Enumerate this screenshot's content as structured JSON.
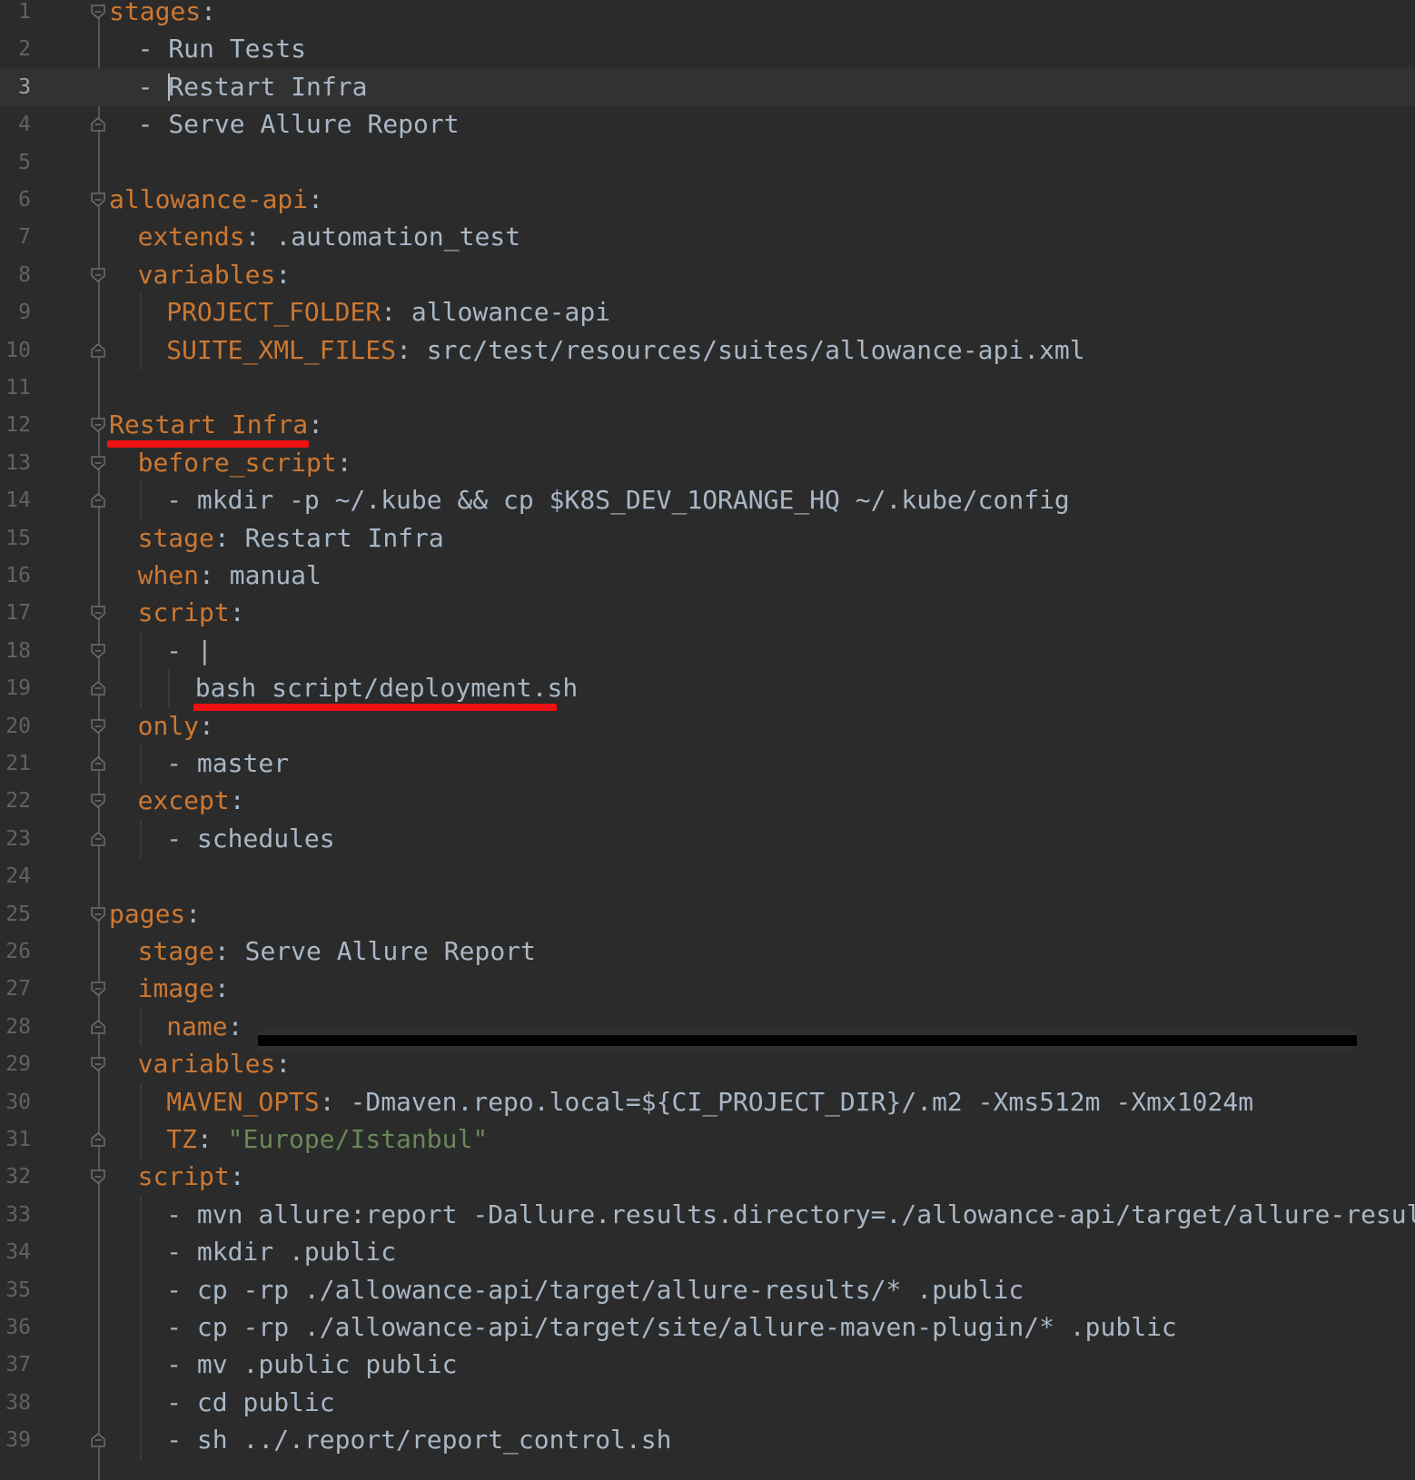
{
  "editor": {
    "theme": "dark",
    "colors": {
      "background": "#2b2b2b",
      "key": "#cc7832",
      "value": "#a9b7c6",
      "string": "#6a8759",
      "line_number": "#606366",
      "highlight": "#ee1111"
    },
    "current_line": 3,
    "lines": [
      {
        "n": "1",
        "indent": 0,
        "fold": "open",
        "key": "stages",
        "colon": ":",
        "value": ""
      },
      {
        "n": "2",
        "indent": 1,
        "fold": "",
        "dash": "- ",
        "value": "Run Tests"
      },
      {
        "n": "3",
        "indent": 1,
        "fold": "",
        "dash": "- ",
        "value": "Restart Infra",
        "caret": true
      },
      {
        "n": "4",
        "indent": 1,
        "fold": "close",
        "dash": "- ",
        "value": "Serve Allure Report"
      },
      {
        "n": "5",
        "indent": 0,
        "fold": "",
        "value": ""
      },
      {
        "n": "6",
        "indent": 0,
        "fold": "open",
        "key": "allowance-api",
        "colon": ":",
        "value": ""
      },
      {
        "n": "7",
        "indent": 1,
        "fold": "",
        "key": "extends",
        "colon": ": ",
        "value": ".automation_test"
      },
      {
        "n": "8",
        "indent": 1,
        "fold": "open",
        "key": "variables",
        "colon": ":",
        "value": ""
      },
      {
        "n": "9",
        "indent": 2,
        "fold": "",
        "key": "PROJECT_FOLDER",
        "colon": ": ",
        "value": "allowance-api"
      },
      {
        "n": "10",
        "indent": 2,
        "fold": "close",
        "key": "SUITE_XML_FILES",
        "colon": ": ",
        "value": "src/test/resources/suites/allowance-api.xml"
      },
      {
        "n": "11",
        "indent": 0,
        "fold": "",
        "value": ""
      },
      {
        "n": "12",
        "indent": 0,
        "fold": "open",
        "key": "Restart Infra",
        "colon": ":",
        "value": ""
      },
      {
        "n": "13",
        "indent": 1,
        "fold": "open",
        "key": "before_script",
        "colon": ":",
        "value": ""
      },
      {
        "n": "14",
        "indent": 2,
        "fold": "close",
        "dash": "- ",
        "value": "mkdir -p ~/.kube && cp $K8S_DEV_1ORANGE_HQ ~/.kube/config"
      },
      {
        "n": "15",
        "indent": 1,
        "fold": "",
        "key": "stage",
        "colon": ": ",
        "value": "Restart Infra"
      },
      {
        "n": "16",
        "indent": 1,
        "fold": "",
        "key": "when",
        "colon": ": ",
        "value": "manual"
      },
      {
        "n": "17",
        "indent": 1,
        "fold": "open",
        "key": "script",
        "colon": ":",
        "value": ""
      },
      {
        "n": "18",
        "indent": 2,
        "fold": "open",
        "dash": "- ",
        "value": "|"
      },
      {
        "n": "19",
        "indent": 3,
        "fold": "close",
        "value": "bash script/deployment.sh"
      },
      {
        "n": "20",
        "indent": 1,
        "fold": "open",
        "key": "only",
        "colon": ":",
        "value": ""
      },
      {
        "n": "21",
        "indent": 2,
        "fold": "close",
        "dash": "- ",
        "value": "master"
      },
      {
        "n": "22",
        "indent": 1,
        "fold": "open",
        "key": "except",
        "colon": ":",
        "value": ""
      },
      {
        "n": "23",
        "indent": 2,
        "fold": "close",
        "dash": "- ",
        "value": "schedules"
      },
      {
        "n": "24",
        "indent": 0,
        "fold": "",
        "value": ""
      },
      {
        "n": "25",
        "indent": 0,
        "fold": "open",
        "key": "pages",
        "colon": ":",
        "value": ""
      },
      {
        "n": "26",
        "indent": 1,
        "fold": "",
        "key": "stage",
        "colon": ": ",
        "value": "Serve Allure Report"
      },
      {
        "n": "27",
        "indent": 1,
        "fold": "open",
        "key": "image",
        "colon": ":",
        "value": ""
      },
      {
        "n": "28",
        "indent": 2,
        "fold": "close",
        "key": "name",
        "colon": ": ",
        "value": "",
        "redacted": true
      },
      {
        "n": "29",
        "indent": 1,
        "fold": "open",
        "key": "variables",
        "colon": ":",
        "value": ""
      },
      {
        "n": "30",
        "indent": 2,
        "fold": "",
        "key": "MAVEN_OPTS",
        "colon": ": ",
        "value": "-Dmaven.repo.local=${CI_PROJECT_DIR}/.m2 -Xms512m -Xmx1024m"
      },
      {
        "n": "31",
        "indent": 2,
        "fold": "close",
        "key": "TZ",
        "colon": ": ",
        "value": "\"Europe/Istanbul\"",
        "string": true
      },
      {
        "n": "32",
        "indent": 1,
        "fold": "open",
        "key": "script",
        "colon": ":",
        "value": ""
      },
      {
        "n": "33",
        "indent": 2,
        "fold": "",
        "dash": "- ",
        "value": "mvn allure:report -Dallure.results.directory=./allowance-api/target/allure-results/"
      },
      {
        "n": "34",
        "indent": 2,
        "fold": "",
        "dash": "- ",
        "value": "mkdir .public"
      },
      {
        "n": "35",
        "indent": 2,
        "fold": "",
        "dash": "- ",
        "value": "cp -rp ./allowance-api/target/allure-results/* .public"
      },
      {
        "n": "36",
        "indent": 2,
        "fold": "",
        "dash": "- ",
        "value": "cp -rp ./allowance-api/target/site/allure-maven-plugin/* .public"
      },
      {
        "n": "37",
        "indent": 2,
        "fold": "",
        "dash": "- ",
        "value": "mv .public public"
      },
      {
        "n": "38",
        "indent": 2,
        "fold": "",
        "dash": "- ",
        "value": "cd public"
      },
      {
        "n": "39",
        "indent": 2,
        "fold": "close",
        "dash": "- ",
        "value": "sh ../.report/report_control.sh"
      }
    ]
  }
}
